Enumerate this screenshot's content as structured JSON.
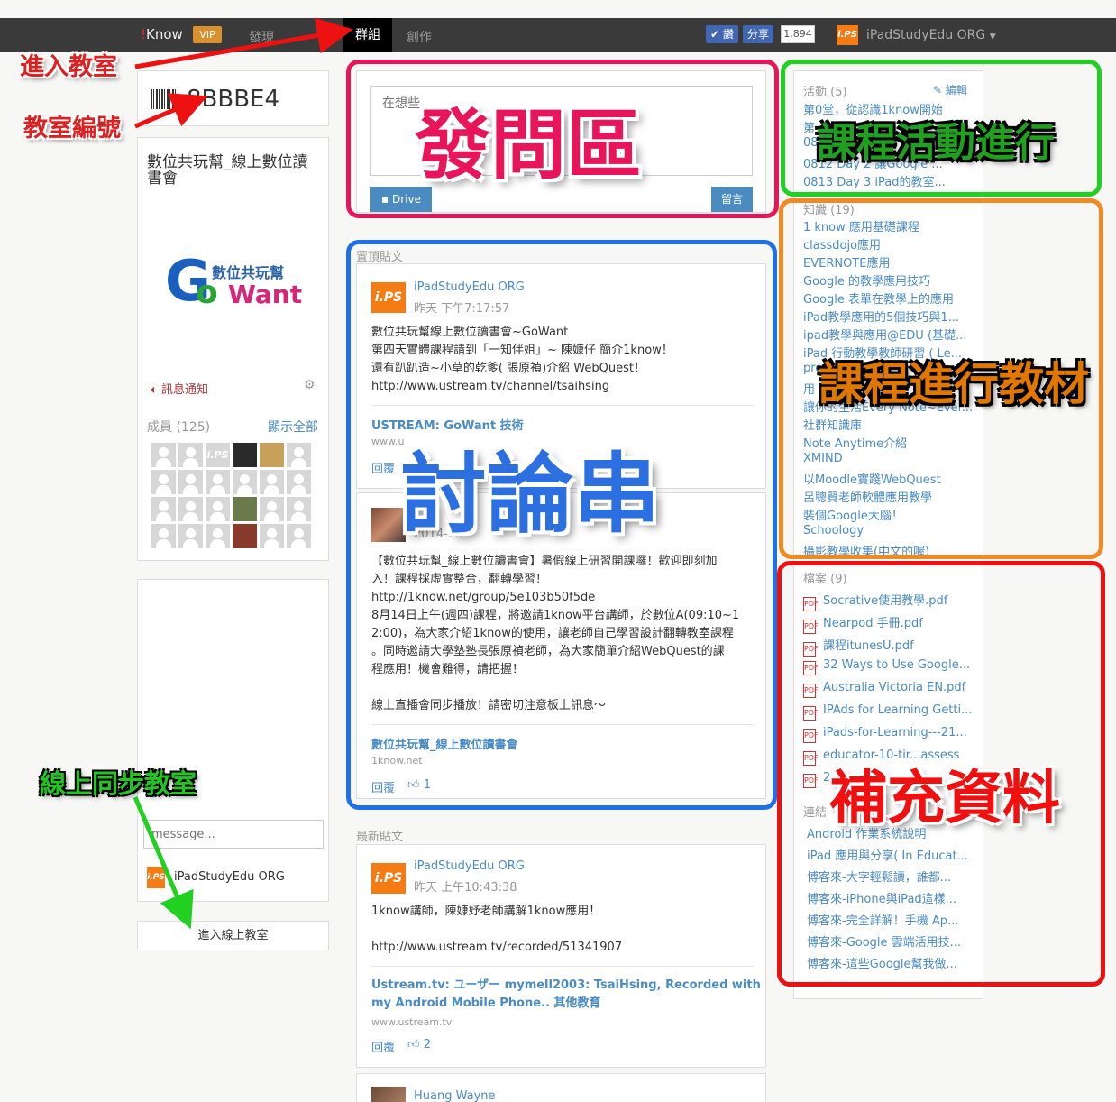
{
  "nav": {
    "brand": "Know",
    "vip": "VIP",
    "discover": "發現",
    "groups": "群組",
    "create": "創作",
    "fb_like": "讚",
    "fb_share": "分享",
    "fb_count": "1,894",
    "user": "iPadStudyEdu ORG"
  },
  "sidebar": {
    "class_code": "8BBBE4",
    "group_name": "數位共玩幫_線上數位讀書會",
    "logo_text": "數位共玩幫",
    "logo_g": "G",
    "logo_o": "o",
    "logo_want": "Want",
    "notify": "訊息通知",
    "members_label": "成員 (125)",
    "show_all": "顯示全部",
    "message_placeholder": "message...",
    "chat_user": "iPadStudyEdu ORG",
    "enter_button": "進入線上教室"
  },
  "compose": {
    "placeholder": "在想些",
    "drive": "Drive",
    "submit": "留言"
  },
  "pinned": {
    "header": "置頂貼文",
    "post1": {
      "author": "iPadStudyEdu ORG",
      "time": "昨天 下午7:17:57",
      "line1": "數位共玩幫線上數位讀書會~GoWant",
      "line2": "第四天實體課程請到「一知伴姐」~ 陳嫝仔 簡介1know！",
      "line3": "還有趴趴造~小草的乾爹( 張原禎)介紹 WebQuest！",
      "url": "http://www.ustream.tv/channel/tsaihsing",
      "link_title": "USTREAM: GoWant 技術",
      "link_domain": "www.u",
      "reply": "回覆"
    },
    "post2": {
      "time": "2014-08-",
      "text1": "【數位共玩幫_線上數位讀書會】暑假線上研習開課囉！歡迎即刻加",
      "text2": "入！課程採虛實整合，翻轉學習！",
      "url": "http://1know.net/group/5e103b50f5de",
      "text3": "8月14日上午(週四)課程，將邀請1know平台講師，於數位A(09:10~1",
      "text4": "2:00)，為大家介紹1know的使用，讓老師自己學習設計翻轉教室課程",
      "text5": "。同時邀請大學塾塾長張原禎老師，為大家簡單介紹WebQuest的課",
      "text6": "程應用！機會難得，請把握！",
      "text7": "線上直播會同步播放！請密切注意板上訊息～",
      "link_title": "數位共玩幫_線上數位讀書會",
      "link_domain": "1know.net",
      "reply": "回覆",
      "likes": "1"
    }
  },
  "latest": {
    "header": "最新貼文",
    "post1": {
      "author": "iPadStudyEdu ORG",
      "time": "昨天 上午10:43:38",
      "text": "1know講師，陳嫝妤老師講解1know應用！",
      "url": "http://www.ustream.tv/recorded/51341907",
      "link_title1": "Ustream.tv: ユーザー mymell2003: TsaiHsing, Recorded with",
      "link_title2": "my Android Mobile Phone.. 其他教育",
      "link_domain": "www.ustream.tv",
      "reply": "回覆",
      "likes": "2"
    },
    "post2": {
      "author": "Huang Wayne"
    }
  },
  "activities": {
    "header": "活動 (5)",
    "edit": "編輯",
    "items": [
      "第0堂，從認識1know開始",
      "第",
      "08",
      "0812 Day 2 讓Google ...",
      "0813 Day 3 iPad的教室..."
    ]
  },
  "knowledge": {
    "header": "知識 (19)",
    "items": [
      "1 know 應用基礎課程",
      "classdojo應用",
      "EVERNOTE應用",
      "Google 的教學應用技巧",
      "Google 表單在教學上的應用",
      "iPad教學應用的5個技巧與1...",
      "ipad教學與應用@EDU (基礎...",
      "iPad 行動教學教師研習 ( Le...",
      "pre",
      "用",
      "讓你的生活Every Note~Ever...",
      "社群知識庫",
      "Note Anytime介紹",
      "XMIND",
      "以Moodle實踐WebQuest",
      "呂聰賢老師軟體應用教學",
      "裝個Google大腦！",
      "Schoology",
      "攝影教學收集(中文的喔)"
    ]
  },
  "files": {
    "header": "檔案 (9)",
    "items": [
      "Socrative使用教學.pdf",
      "Nearpod 手冊.pdf",
      "課程itunesU.pdf",
      "32 Ways to Use Google...",
      "Australia Victoria EN.pdf",
      "IPAds for Learning Getti...",
      "iPads-for-Learning---21...",
      "educator-10-tir...assess",
      "2"
    ],
    "pdf_icon": "pdf-icon"
  },
  "links": {
    "header": "連結",
    "items": [
      "Android 作業系統說明",
      "iPad 應用與分享( In Educat...",
      "博客來-大字輕鬆讀，誰都...",
      "博客來-iPhone與iPad這樣...",
      "博客來-完全詳解！手機 Ap...",
      "博客來-Google 雲端活用技...",
      "博客來-這些Google幫我做..."
    ]
  },
  "annotations": {
    "enter_classroom": "進入教室",
    "class_number": "教室編號",
    "online_classroom": "線上同步教室",
    "question_area": "發問區",
    "discussion": "討論串",
    "activities": "課程活動進行",
    "materials": "課程進行教材",
    "supplement": "補充資料"
  },
  "colors": {
    "navbar": "#3a3a3a",
    "accent_link": "#4a8bc2",
    "pink_box": "#e8155b",
    "blue_box": "#1f6fe6",
    "green_box": "#22d022",
    "orange_box": "#f08a24",
    "red_box": "#ee1111",
    "annotation_red": "#e02020",
    "annotation_green": "#23c523"
  }
}
